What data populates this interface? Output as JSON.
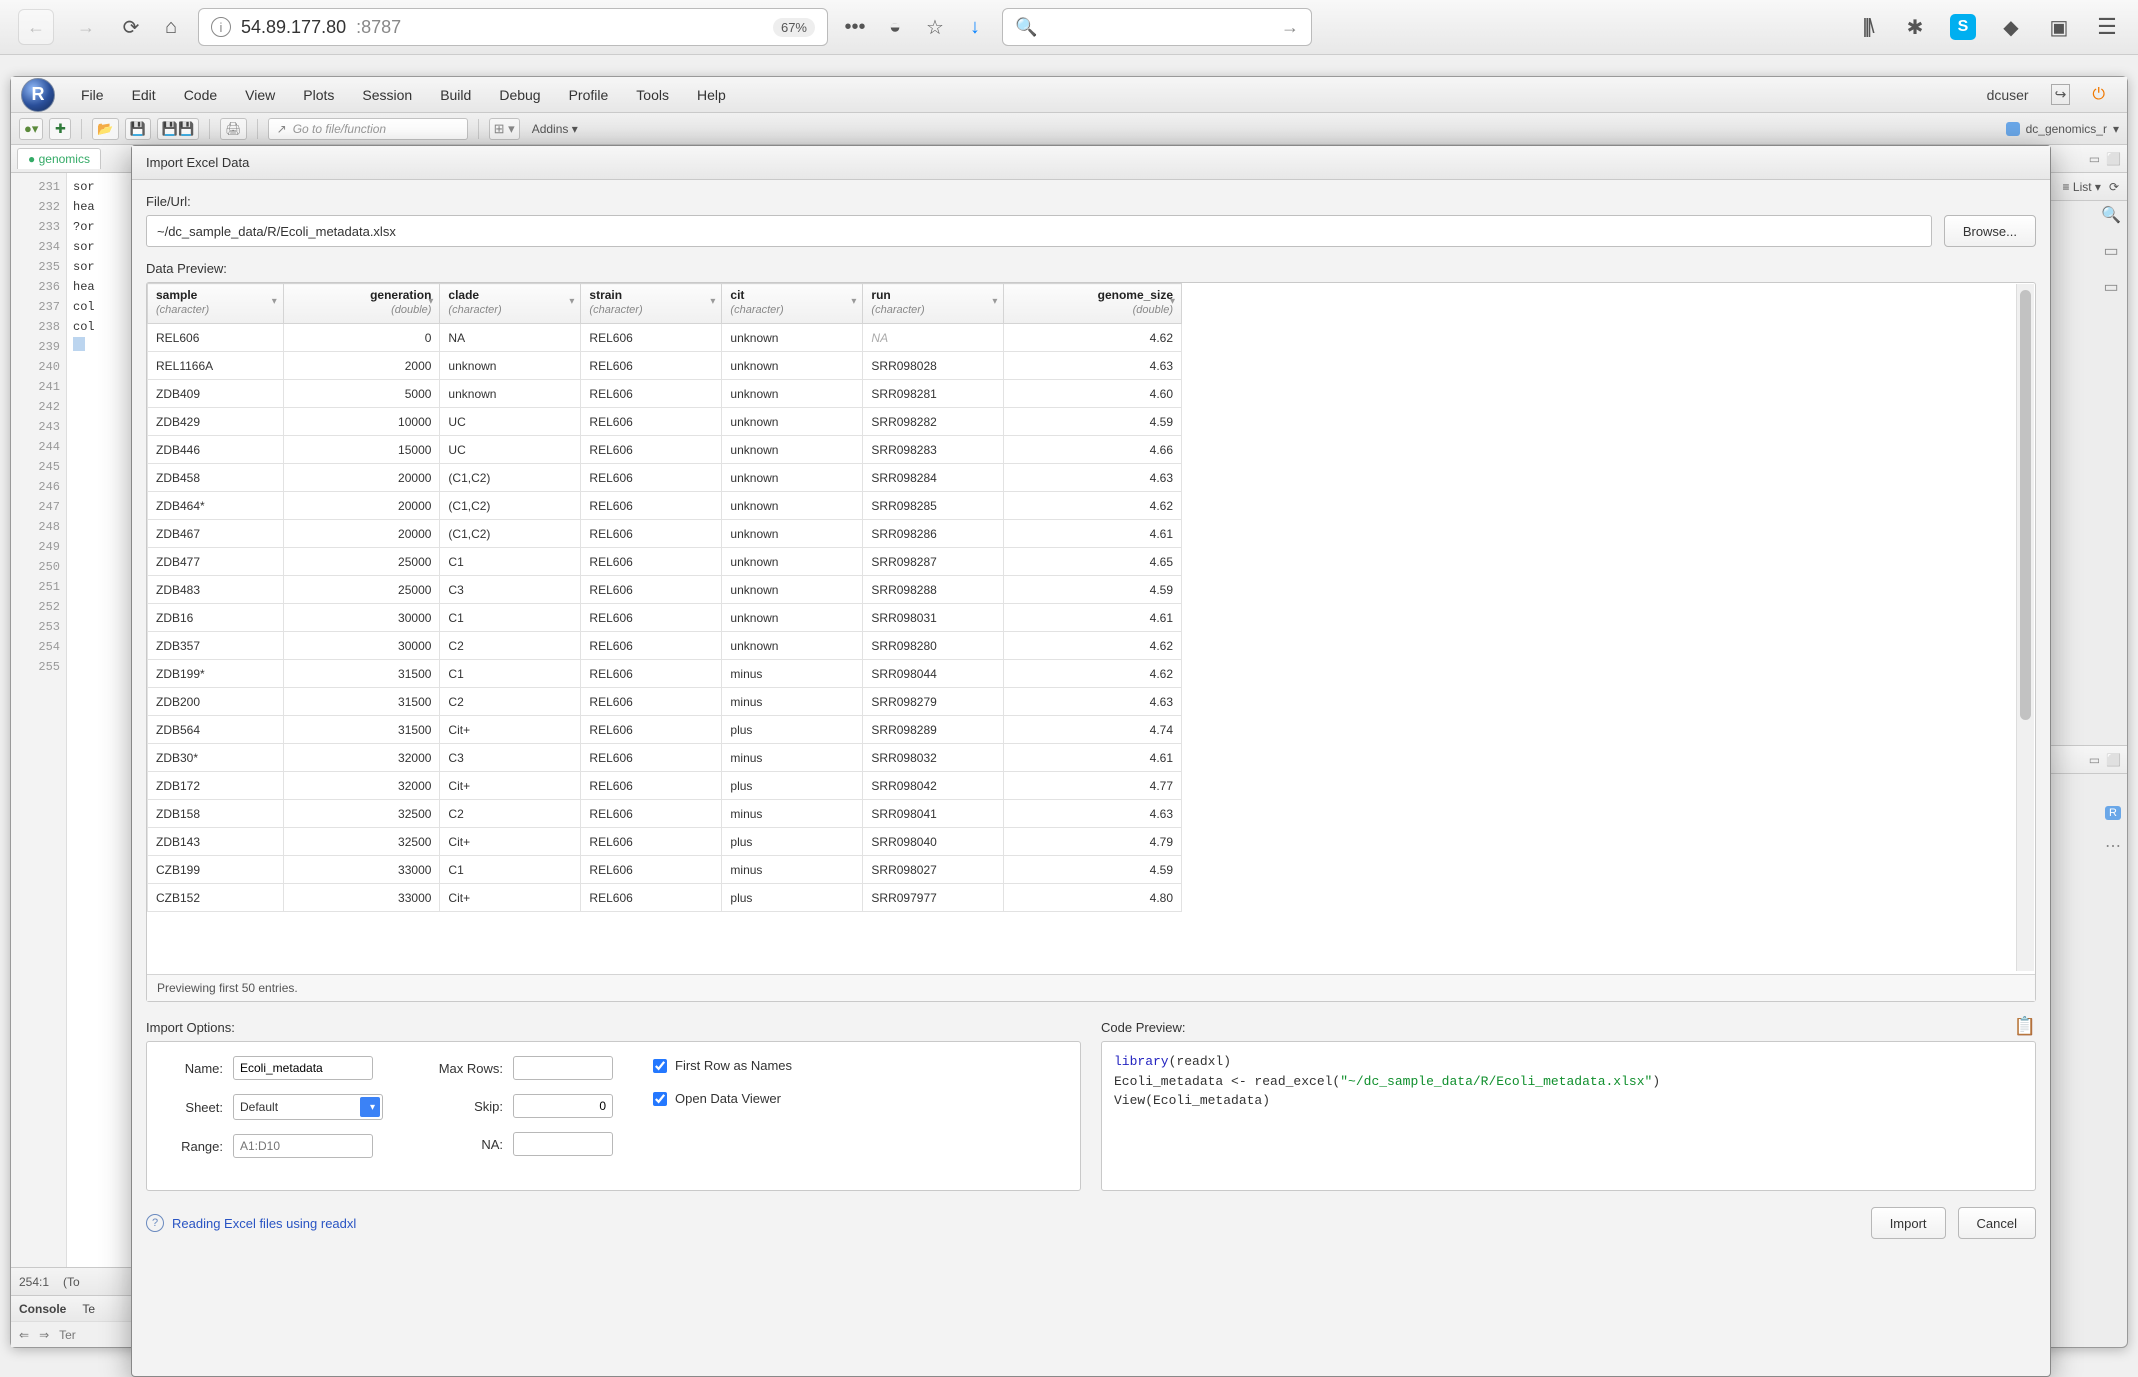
{
  "browser": {
    "url_main": "54.89.177.80",
    "url_port": ":8787",
    "zoom": "67%"
  },
  "rstudio": {
    "menus": [
      "File",
      "Edit",
      "Code",
      "View",
      "Plots",
      "Session",
      "Build",
      "Debug",
      "Profile",
      "Tools",
      "Help"
    ],
    "user": "dcuser",
    "project": "dc_genomics_r",
    "goto_placeholder": "Go to file/function",
    "addins": "Addins",
    "source_tab": "genomics",
    "status_pos": "254:1",
    "status_right": "(To",
    "console_tab": "Console",
    "terminal_tab": "Te",
    "console_path": "Ter",
    "env_list": "List",
    "gutter_lines": [
      "231",
      "232",
      "233",
      "234",
      "235",
      "236",
      "237",
      "238",
      "239",
      "240",
      "241",
      "242",
      "243",
      "244",
      "245",
      "246",
      "247",
      "248",
      "249",
      "250",
      "251",
      "252",
      "253",
      "254",
      "255"
    ],
    "code_lines": [
      "sor",
      "hea",
      "",
      "",
      "?or",
      "",
      "sor",
      "sor",
      "hea",
      "",
      "",
      "col",
      "",
      "col",
      "",
      "",
      "",
      "",
      "",
      "",
      "",
      "",
      "",
      "",
      " "
    ]
  },
  "modal": {
    "title": "Import Excel Data",
    "file_label": "File/Url:",
    "file_value": "~/dc_sample_data/R/Ecoli_metadata.xlsx",
    "browse": "Browse...",
    "preview_label": "Data Preview:",
    "preview_footer": "Previewing first 50 entries.",
    "options_label": "Import Options:",
    "code_label": "Code Preview:",
    "help_link": "Reading Excel files using readxl",
    "import_btn": "Import",
    "cancel_btn": "Cancel",
    "columns": [
      {
        "name": "sample",
        "type": "(character)"
      },
      {
        "name": "generation",
        "type": "(double)"
      },
      {
        "name": "clade",
        "type": "(character)"
      },
      {
        "name": "strain",
        "type": "(character)"
      },
      {
        "name": "cit",
        "type": "(character)"
      },
      {
        "name": "run",
        "type": "(character)"
      },
      {
        "name": "genome_size",
        "type": "(double)"
      }
    ],
    "rows": [
      {
        "sample": "REL606",
        "generation": "0",
        "clade": "NA",
        "strain": "REL606",
        "cit": "unknown",
        "run": "NA",
        "run_na": true,
        "genome_size": "4.62"
      },
      {
        "sample": "REL1166A",
        "generation": "2000",
        "clade": "unknown",
        "strain": "REL606",
        "cit": "unknown",
        "run": "SRR098028",
        "genome_size": "4.63"
      },
      {
        "sample": "ZDB409",
        "generation": "5000",
        "clade": "unknown",
        "strain": "REL606",
        "cit": "unknown",
        "run": "SRR098281",
        "genome_size": "4.60"
      },
      {
        "sample": "ZDB429",
        "generation": "10000",
        "clade": "UC",
        "strain": "REL606",
        "cit": "unknown",
        "run": "SRR098282",
        "genome_size": "4.59"
      },
      {
        "sample": "ZDB446",
        "generation": "15000",
        "clade": "UC",
        "strain": "REL606",
        "cit": "unknown",
        "run": "SRR098283",
        "genome_size": "4.66"
      },
      {
        "sample": "ZDB458",
        "generation": "20000",
        "clade": "(C1,C2)",
        "strain": "REL606",
        "cit": "unknown",
        "run": "SRR098284",
        "genome_size": "4.63"
      },
      {
        "sample": "ZDB464*",
        "generation": "20000",
        "clade": "(C1,C2)",
        "strain": "REL606",
        "cit": "unknown",
        "run": "SRR098285",
        "genome_size": "4.62"
      },
      {
        "sample": "ZDB467",
        "generation": "20000",
        "clade": "(C1,C2)",
        "strain": "REL606",
        "cit": "unknown",
        "run": "SRR098286",
        "genome_size": "4.61"
      },
      {
        "sample": "ZDB477",
        "generation": "25000",
        "clade": "C1",
        "strain": "REL606",
        "cit": "unknown",
        "run": "SRR098287",
        "genome_size": "4.65"
      },
      {
        "sample": "ZDB483",
        "generation": "25000",
        "clade": "C3",
        "strain": "REL606",
        "cit": "unknown",
        "run": "SRR098288",
        "genome_size": "4.59"
      },
      {
        "sample": "ZDB16",
        "generation": "30000",
        "clade": "C1",
        "strain": "REL606",
        "cit": "unknown",
        "run": "SRR098031",
        "genome_size": "4.61"
      },
      {
        "sample": "ZDB357",
        "generation": "30000",
        "clade": "C2",
        "strain": "REL606",
        "cit": "unknown",
        "run": "SRR098280",
        "genome_size": "4.62"
      },
      {
        "sample": "ZDB199*",
        "generation": "31500",
        "clade": "C1",
        "strain": "REL606",
        "cit": "minus",
        "run": "SRR098044",
        "genome_size": "4.62"
      },
      {
        "sample": "ZDB200",
        "generation": "31500",
        "clade": "C2",
        "strain": "REL606",
        "cit": "minus",
        "run": "SRR098279",
        "genome_size": "4.63"
      },
      {
        "sample": "ZDB564",
        "generation": "31500",
        "clade": "Cit+",
        "strain": "REL606",
        "cit": "plus",
        "run": "SRR098289",
        "genome_size": "4.74"
      },
      {
        "sample": "ZDB30*",
        "generation": "32000",
        "clade": "C3",
        "strain": "REL606",
        "cit": "minus",
        "run": "SRR098032",
        "genome_size": "4.61"
      },
      {
        "sample": "ZDB172",
        "generation": "32000",
        "clade": "Cit+",
        "strain": "REL606",
        "cit": "plus",
        "run": "SRR098042",
        "genome_size": "4.77"
      },
      {
        "sample": "ZDB158",
        "generation": "32500",
        "clade": "C2",
        "strain": "REL606",
        "cit": "minus",
        "run": "SRR098041",
        "genome_size": "4.63"
      },
      {
        "sample": "ZDB143",
        "generation": "32500",
        "clade": "Cit+",
        "strain": "REL606",
        "cit": "plus",
        "run": "SRR098040",
        "genome_size": "4.79"
      },
      {
        "sample": "CZB199",
        "generation": "33000",
        "clade": "C1",
        "strain": "REL606",
        "cit": "minus",
        "run": "SRR098027",
        "genome_size": "4.59"
      },
      {
        "sample": "CZB152",
        "generation": "33000",
        "clade": "Cit+",
        "strain": "REL606",
        "cit": "plus",
        "run": "SRR097977",
        "genome_size": "4.80"
      }
    ],
    "options": {
      "name_label": "Name:",
      "name_value": "Ecoli_metadata",
      "sheet_label": "Sheet:",
      "sheet_value": "Default",
      "range_label": "Range:",
      "range_placeholder": "A1:D10",
      "maxrows_label": "Max Rows:",
      "maxrows_value": "",
      "skip_label": "Skip:",
      "skip_value": "0",
      "na_label": "NA:",
      "na_value": "",
      "first_row": "First Row as Names",
      "open_viewer": "Open Data Viewer"
    },
    "code": {
      "l1a": "library",
      "l1b": "(readxl)",
      "l2": "Ecoli_metadata <- read_excel(",
      "l2s": "\"~/dc_sample_data/R/Ecoli_metadata.xlsx\"",
      "l2e": ")",
      "l3": "View(Ecoli_metadata)"
    }
  }
}
